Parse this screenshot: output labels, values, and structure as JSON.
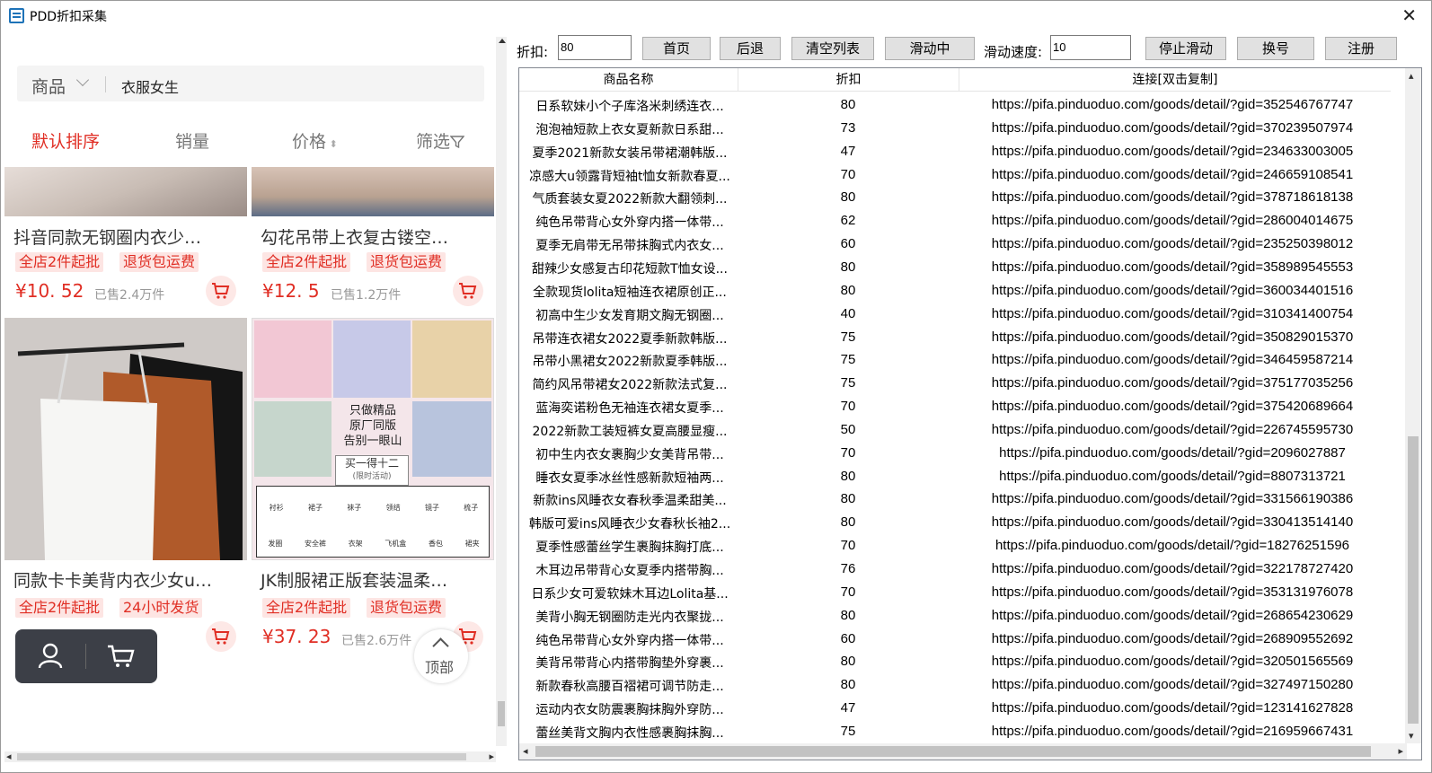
{
  "window": {
    "title": "PDD折扣采集",
    "close_glyph": "✕"
  },
  "left": {
    "search": {
      "category": "商品",
      "query": "衣服女生"
    },
    "sort": [
      {
        "label": "默认排序",
        "active": true
      },
      {
        "label": "销量",
        "active": false
      },
      {
        "label": "价格",
        "active": false
      },
      {
        "label": "筛选",
        "active": false
      }
    ],
    "products": [
      {
        "title": "抖音同款无钢圈内衣少…",
        "tags": [
          "全店2件起批",
          "退货包运费"
        ],
        "price": "¥10. 52",
        "sold": "已售2.4万件"
      },
      {
        "title": "勾花吊带上衣复古镂空…",
        "tags": [
          "全店2件起批",
          "退货包运费"
        ],
        "price": "¥12. 5",
        "sold": "已售1.2万件"
      },
      {
        "title": "同款卡卡美背内衣少女u…",
        "tags": [
          "全店2件起批",
          "24小时发货"
        ],
        "price": "",
        "sold": ""
      },
      {
        "title": "JK制服裙正版套装温柔…",
        "tags": [
          "全店2件起批",
          "退货包运费"
        ],
        "price": "¥37. 23",
        "sold": "已售2.6万件"
      }
    ],
    "promo": {
      "line1": "只做精品",
      "line2": "原厂同版",
      "line3": "告别一眼山",
      "badge": "买一得十二",
      "badge_sub": "(限时活动)",
      "items": [
        "衬衫",
        "裙子",
        "袜子",
        "领结",
        "镜子",
        "梳子",
        "发圈",
        "安全裤",
        "衣架",
        "飞机盒",
        "香包",
        "裙夹"
      ]
    },
    "top_label": "顶部"
  },
  "toolbar": {
    "discount_label": "折扣:",
    "discount_value": "80",
    "btn_home": "首页",
    "btn_back": "后退",
    "btn_clear": "清空列表",
    "btn_scroll": "滑动中",
    "speed_label": "滑动速度:",
    "speed_value": "10",
    "btn_stop": "停止滑动",
    "btn_switch": "换号",
    "btn_register": "注册"
  },
  "table": {
    "headers": [
      "商品名称",
      "折扣",
      "连接[双击复制]"
    ],
    "rows": [
      {
        "name": "日系软妹小个子库洛米刺绣连衣...",
        "discount": "80",
        "link": "https://pifa.pinduoduo.com/goods/detail/?gid=352546767747"
      },
      {
        "name": "泡泡袖短款上衣女夏新款日系甜...",
        "discount": "73",
        "link": "https://pifa.pinduoduo.com/goods/detail/?gid=370239507974"
      },
      {
        "name": "夏季2021新款女装吊带裙潮韩版...",
        "discount": "47",
        "link": "https://pifa.pinduoduo.com/goods/detail/?gid=234633003005"
      },
      {
        "name": "凉感大u领露背短袖t恤女新款春夏...",
        "discount": "70",
        "link": "https://pifa.pinduoduo.com/goods/detail/?gid=246659108541"
      },
      {
        "name": "气质套装女夏2022新款大翻领刺...",
        "discount": "80",
        "link": "https://pifa.pinduoduo.com/goods/detail/?gid=378718618138"
      },
      {
        "name": "纯色吊带背心女外穿内搭一体带...",
        "discount": "62",
        "link": "https://pifa.pinduoduo.com/goods/detail/?gid=286004014675"
      },
      {
        "name": "夏季无肩带无吊带抹胸式内衣女...",
        "discount": "60",
        "link": "https://pifa.pinduoduo.com/goods/detail/?gid=235250398012"
      },
      {
        "name": "甜辣少女感复古印花短款T恤女设...",
        "discount": "80",
        "link": "https://pifa.pinduoduo.com/goods/detail/?gid=358989545553"
      },
      {
        "name": "全款现货lolita短袖连衣裙原创正...",
        "discount": "80",
        "link": "https://pifa.pinduoduo.com/goods/detail/?gid=360034401516"
      },
      {
        "name": "初高中生少女发育期文胸无钢圈...",
        "discount": "40",
        "link": "https://pifa.pinduoduo.com/goods/detail/?gid=310341400754"
      },
      {
        "name": "吊带连衣裙女2022夏季新款韩版...",
        "discount": "75",
        "link": "https://pifa.pinduoduo.com/goods/detail/?gid=350829015370"
      },
      {
        "name": "吊带小黑裙女2022新款夏季韩版...",
        "discount": "75",
        "link": "https://pifa.pinduoduo.com/goods/detail/?gid=346459587214"
      },
      {
        "name": "简约风吊带裙女2022新款法式复...",
        "discount": "75",
        "link": "https://pifa.pinduoduo.com/goods/detail/?gid=375177035256"
      },
      {
        "name": "蓝海奕诺粉色无袖连衣裙女夏季...",
        "discount": "70",
        "link": "https://pifa.pinduoduo.com/goods/detail/?gid=375420689664"
      },
      {
        "name": "2022新款工装短裤女夏高腰显瘦...",
        "discount": "50",
        "link": "https://pifa.pinduoduo.com/goods/detail/?gid=226745595730"
      },
      {
        "name": "初中生内衣女裹胸少女美背吊带...",
        "discount": "70",
        "link": "https://pifa.pinduoduo.com/goods/detail/?gid=2096027887"
      },
      {
        "name": "睡衣女夏季冰丝性感新款短袖两...",
        "discount": "80",
        "link": "https://pifa.pinduoduo.com/goods/detail/?gid=8807313721"
      },
      {
        "name": "新款ins风睡衣女春秋季温柔甜美...",
        "discount": "80",
        "link": "https://pifa.pinduoduo.com/goods/detail/?gid=331566190386"
      },
      {
        "name": "韩版可爱ins风睡衣少女春秋长袖2...",
        "discount": "80",
        "link": "https://pifa.pinduoduo.com/goods/detail/?gid=330413514140"
      },
      {
        "name": "夏季性感蕾丝学生裹胸抹胸打底...",
        "discount": "70",
        "link": "https://pifa.pinduoduo.com/goods/detail/?gid=18276251596"
      },
      {
        "name": "木耳边吊带背心女夏季内搭带胸...",
        "discount": "76",
        "link": "https://pifa.pinduoduo.com/goods/detail/?gid=322178727420"
      },
      {
        "name": "日系少女可爱软妹木耳边Lolita基...",
        "discount": "70",
        "link": "https://pifa.pinduoduo.com/goods/detail/?gid=353131976078"
      },
      {
        "name": "美背小胸无钢圈防走光内衣聚拢...",
        "discount": "80",
        "link": "https://pifa.pinduoduo.com/goods/detail/?gid=268654230629"
      },
      {
        "name": "纯色吊带背心女外穿内搭一体带...",
        "discount": "60",
        "link": "https://pifa.pinduoduo.com/goods/detail/?gid=268909552692"
      },
      {
        "name": "美背吊带背心内搭带胸垫外穿裹...",
        "discount": "80",
        "link": "https://pifa.pinduoduo.com/goods/detail/?gid=320501565569"
      },
      {
        "name": "新款春秋高腰百褶裙可调节防走...",
        "discount": "80",
        "link": "https://pifa.pinduoduo.com/goods/detail/?gid=327497150280"
      },
      {
        "name": "运动内衣女防震裹胸抹胸外穿防...",
        "discount": "47",
        "link": "https://pifa.pinduoduo.com/goods/detail/?gid=123141627828"
      },
      {
        "name": "蕾丝美背文胸内衣性感裹胸抹胸...",
        "discount": "75",
        "link": "https://pifa.pinduoduo.com/goods/detail/?gid=216959667431"
      }
    ]
  },
  "colors": {
    "accent": "#e02e24",
    "tag_bg": "#fde5e3",
    "nav_dark": "#3c3f47"
  },
  "icons": [
    "app-icon",
    "close-icon",
    "chevron-down-icon",
    "sort-arrows-icon",
    "filter-icon",
    "cart-icon",
    "user-icon",
    "top-arrow-icon"
  ]
}
